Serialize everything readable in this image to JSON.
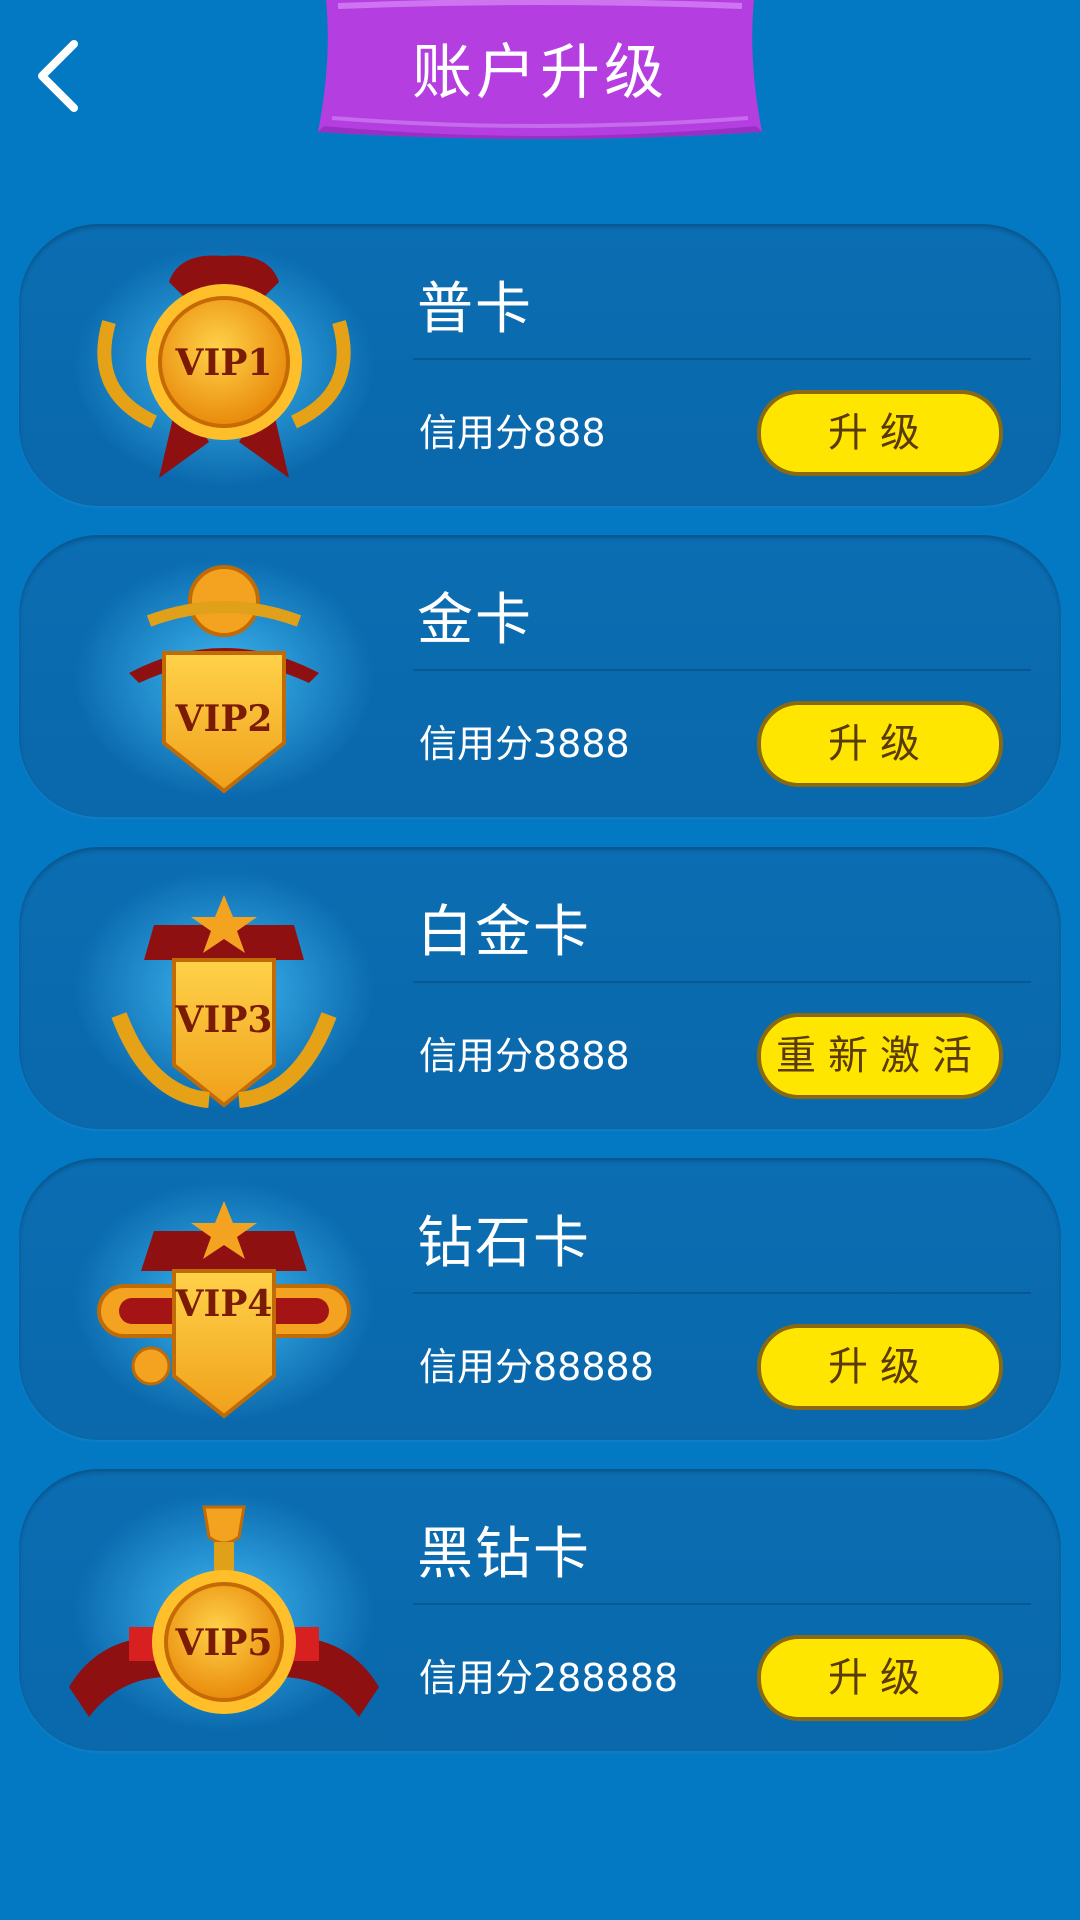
{
  "header": {
    "title": "账户升级"
  },
  "colors": {
    "background": "#0378c3",
    "banner": "#b33ae0",
    "button": "#ffe600",
    "card": "#0a69ad"
  },
  "cards": [
    {
      "badge_text": "VIP1",
      "title": "普卡",
      "credit": "信用分888",
      "button": "升级"
    },
    {
      "badge_text": "VIP2",
      "title": "金卡",
      "credit": "信用分3888",
      "button": "升级"
    },
    {
      "badge_text": "VIP3",
      "title": "白金卡",
      "credit": "信用分8888",
      "button": "重新激活"
    },
    {
      "badge_text": "VIP4",
      "title": "钻石卡",
      "credit": "信用分88888",
      "button": "升级"
    },
    {
      "badge_text": "VIP5",
      "title": "黑钻卡",
      "credit": "信用分288888",
      "button": "升级"
    }
  ]
}
